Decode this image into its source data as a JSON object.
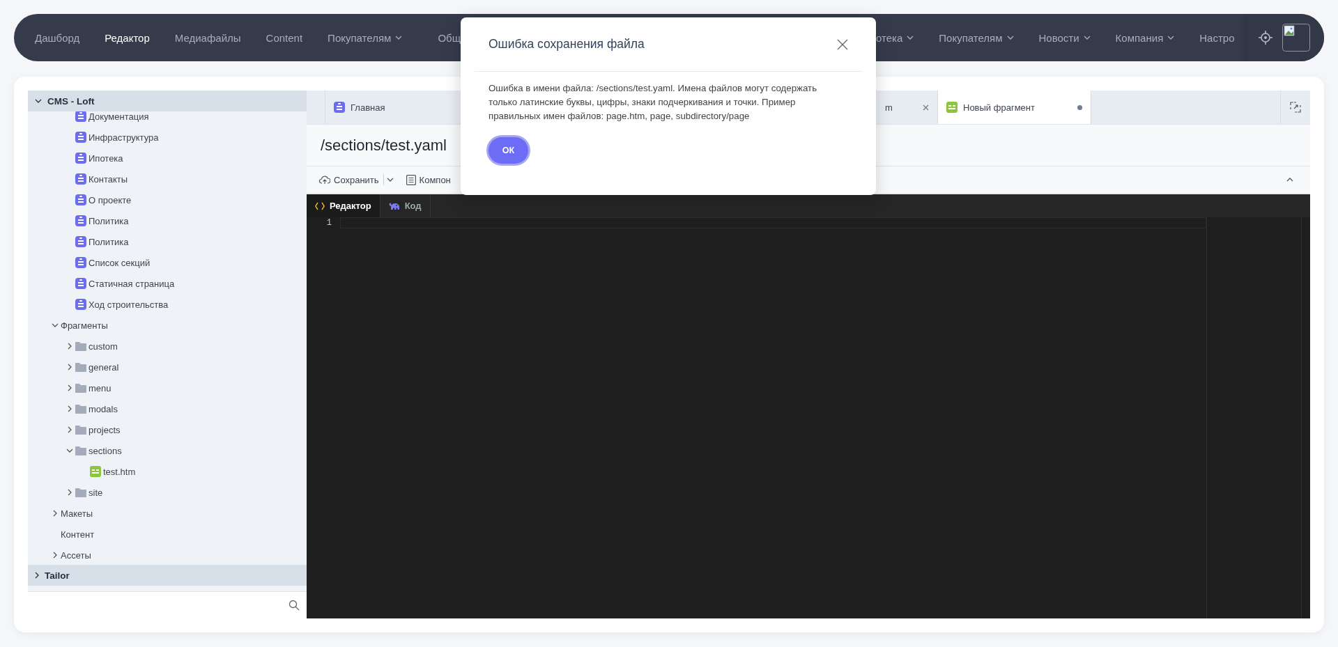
{
  "nav": {
    "left_items": [
      {
        "label": "Дашборд",
        "selected": false,
        "has_menu": false
      },
      {
        "label": "Редактор",
        "selected": true,
        "has_menu": false
      },
      {
        "label": "Медиафайлы",
        "selected": false,
        "has_menu": false
      },
      {
        "label": "Content",
        "selected": false,
        "has_menu": false
      },
      {
        "label": "Покупателям",
        "selected": false,
        "has_menu": true
      },
      {
        "label": "Общ",
        "selected": false,
        "has_menu": false
      }
    ],
    "right_items": [
      {
        "label": "отека",
        "selected": false,
        "has_menu": true
      },
      {
        "label": "Покупателям",
        "selected": false,
        "has_menu": true
      },
      {
        "label": "Новости",
        "selected": false,
        "has_menu": true
      },
      {
        "label": "Компания",
        "selected": false,
        "has_menu": true
      },
      {
        "label": "Настро",
        "selected": false,
        "has_menu": false
      }
    ]
  },
  "sidebar": {
    "sections": [
      {
        "title": "CMS - Loft",
        "expanded": true,
        "items": [
          {
            "children": [
              {
                "label": "Документация",
                "kind": "page"
              },
              {
                "label": "Инфраструктура",
                "kind": "page"
              },
              {
                "label": "Ипотека",
                "kind": "page"
              },
              {
                "label": "Контакты",
                "kind": "page"
              },
              {
                "label": "О проекте",
                "kind": "page"
              },
              {
                "label": "Политика",
                "kind": "page"
              },
              {
                "label": "Политика",
                "kind": "page"
              },
              {
                "label": "Список секций",
                "kind": "page"
              },
              {
                "label": "Статичная страница",
                "kind": "page"
              },
              {
                "label": "Ход строительства",
                "kind": "page"
              }
            ]
          },
          {
            "label": "Фрагменты",
            "expanded": true,
            "children": [
              {
                "label": "custom",
                "kind": "folder",
                "expanded": false
              },
              {
                "label": "general",
                "kind": "folder",
                "expanded": false
              },
              {
                "label": "menu",
                "kind": "folder",
                "expanded": false
              },
              {
                "label": "modals",
                "kind": "folder",
                "expanded": false
              },
              {
                "label": "projects",
                "kind": "folder",
                "expanded": false
              },
              {
                "label": "sections",
                "kind": "folder",
                "expanded": true,
                "children": [
                  {
                    "label": "test.htm",
                    "kind": "fragment"
                  }
                ]
              },
              {
                "label": "site",
                "kind": "folder",
                "expanded": false
              }
            ]
          },
          {
            "label": "Макеты",
            "expanded": false
          },
          {
            "label": "Контент"
          },
          {
            "label": "Ассеты",
            "expanded": false
          }
        ]
      },
      {
        "title": "Tailor",
        "expanded": false
      }
    ]
  },
  "tabs": [
    {
      "label": "Главная",
      "kind": "page",
      "closable": false,
      "modified": false,
      "selected": false
    },
    {
      "label": "m",
      "closable": true,
      "modified": false,
      "selected": false
    },
    {
      "label": "Новый фрагмент",
      "kind": "fragment",
      "closable": false,
      "modified": true,
      "selected": true
    }
  ],
  "document": {
    "title": "/sections/test.yaml"
  },
  "toolbar": {
    "save": "Сохранить",
    "components": "Компон"
  },
  "editor": {
    "tabs": [
      {
        "label": "Редактор",
        "kind": "code",
        "selected": true
      },
      {
        "label": "Код",
        "kind": "elephant",
        "selected": false
      }
    ],
    "lines": [
      "1"
    ]
  },
  "modal": {
    "title": "Ошибка сохранения файла",
    "message": "Ошибка в имени файла: /sections/test.yaml. Имена файлов могут содержать только латинские буквы, цифры, знаки подчеркивания и точки. Пример правильных имен файлов: page.htm, page, subdirectory/page",
    "button": "ОК"
  }
}
